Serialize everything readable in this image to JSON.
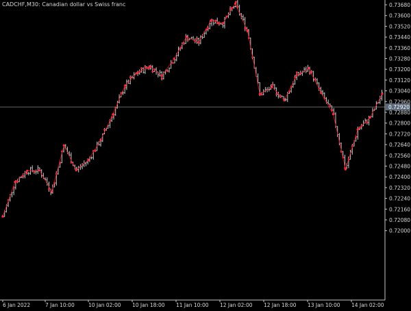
{
  "header": {
    "symbol_label": "CADCHF,M30:",
    "description": "Canadian dollar vs Swiss franc"
  },
  "colors": {
    "background": "#000000",
    "axis": "#c8c8c8",
    "text": "#d8d8d8",
    "bar_up": "#c8c8c8",
    "bar_down": "#c8c8c8",
    "zigzag": "#e01020",
    "marker": "#ff2a3a",
    "bid_line": "#8a8a8a",
    "price_label_bg": "#5a6a7a"
  },
  "price_axis": {
    "labels": [
      "0.73680",
      "0.73600",
      "0.73520",
      "0.73440",
      "0.73360",
      "0.73280",
      "0.73200",
      "0.73120",
      "0.73040",
      "0.72960",
      "0.72880",
      "0.72800",
      "0.72720",
      "0.72640",
      "0.72560",
      "0.72480",
      "0.72400",
      "0.72320",
      "0.72240",
      "0.72160",
      "0.72080",
      "0.72000"
    ],
    "current_price": "0.72920"
  },
  "time_axis": {
    "labels": [
      "6 Jan 2022",
      "7 Jan 10:00",
      "10 Jan 02:00",
      "10 Jan 18:00",
      "11 Jan 10:00",
      "12 Jan 02:00",
      "12 Jan 18:00",
      "13 Jan 10:00",
      "14 Jan 02:00"
    ]
  },
  "chart_data": {
    "type": "line",
    "instrument": "CADCHF",
    "timeframe": "M30",
    "ylim": [
      0.7207,
      0.7372
    ],
    "series": [
      {
        "name": "",
        "values": [
          0.72105,
          0.72362,
          0.72446,
          0.72449,
          0.7229,
          0.72634,
          0.72449,
          0.72526,
          0.72674,
          0.72865,
          0.7308,
          0.73174,
          0.73222,
          0.73152,
          0.73279,
          0.73442,
          0.73401,
          0.73563,
          0.73544,
          0.73689,
          0.73483,
          0.73015,
          0.73069,
          0.72969,
          0.73155,
          0.73208,
          0.73025,
          0.72866,
          0.72456,
          0.72753,
          0.72841,
          0.73018
        ]
      }
    ]
  }
}
